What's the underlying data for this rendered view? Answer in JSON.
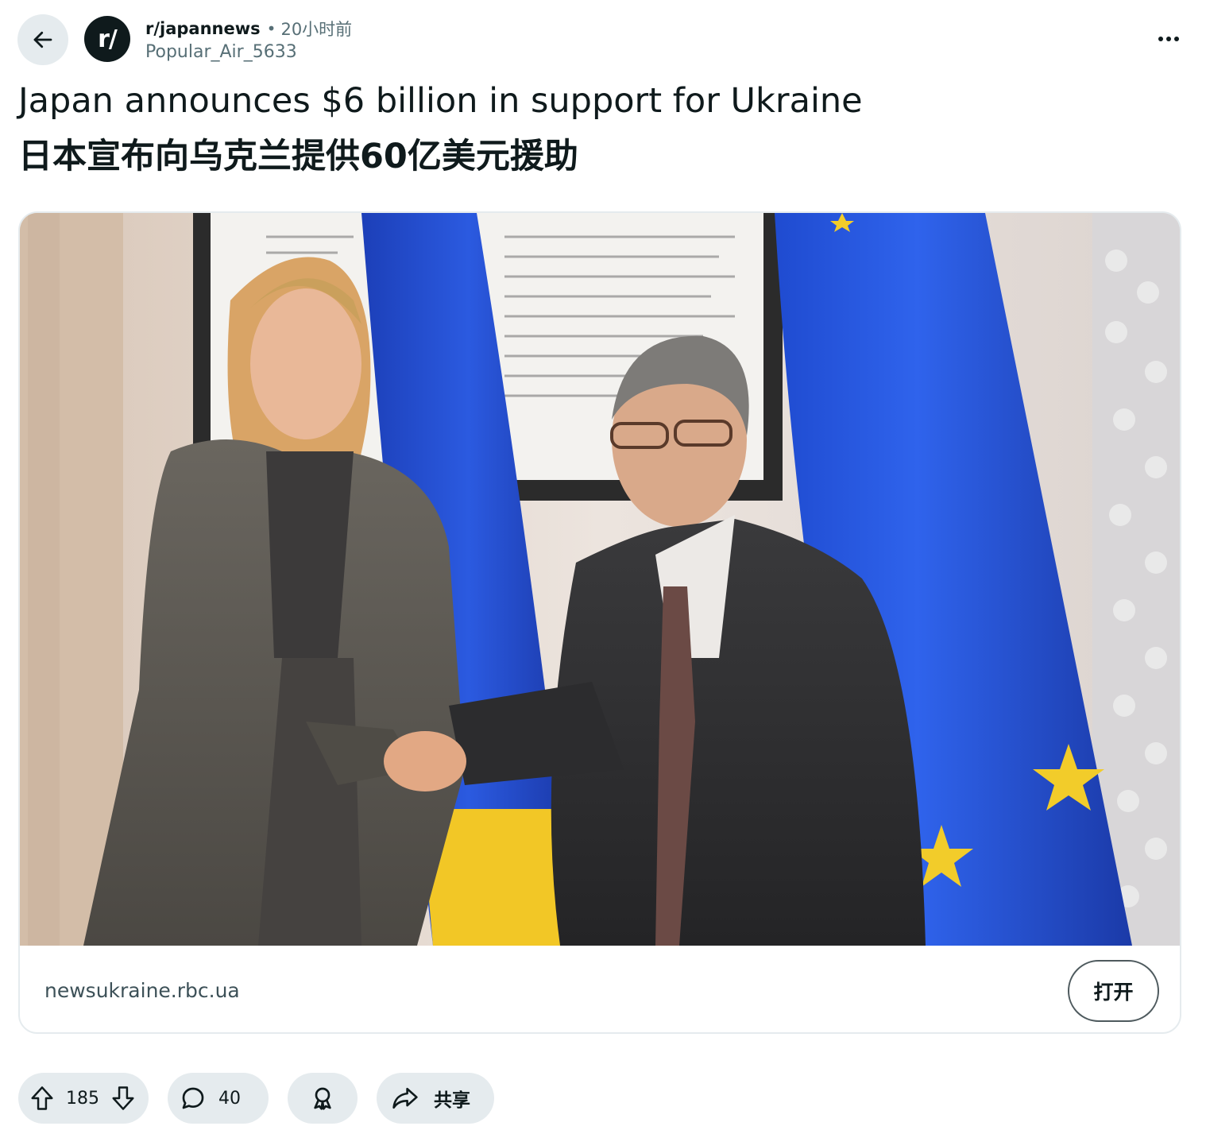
{
  "post": {
    "subreddit": "r/japannews",
    "separator": "•",
    "time": "20小时前",
    "author": "Popular_Air_5633",
    "title_en": "Japan announces $6 billion in support for Ukraine",
    "title_zh": "日本宣布向乌克兰提供60亿美元援助"
  },
  "subreddit_avatar_text": "r/",
  "link_card": {
    "domain": "newsukraine.rbc.ua",
    "open_label": "打开"
  },
  "actions": {
    "upvotes": "185",
    "comments": "40",
    "share_label": "共享"
  },
  "colors": {
    "pill_bg": "#e5ebee",
    "eu_blue": "#1f46c9",
    "eu_star": "#f2cc2a",
    "ua_yellow": "#f5cd2c",
    "text": "#0f1a1c",
    "muted": "#576f76"
  },
  "icons": {
    "back": "arrow-left-icon",
    "more": "more-horizontal-icon",
    "upvote": "arrow-up-icon",
    "downvote": "arrow-down-icon",
    "comment": "speech-bubble-icon",
    "award": "award-icon",
    "share": "share-arrow-icon"
  }
}
